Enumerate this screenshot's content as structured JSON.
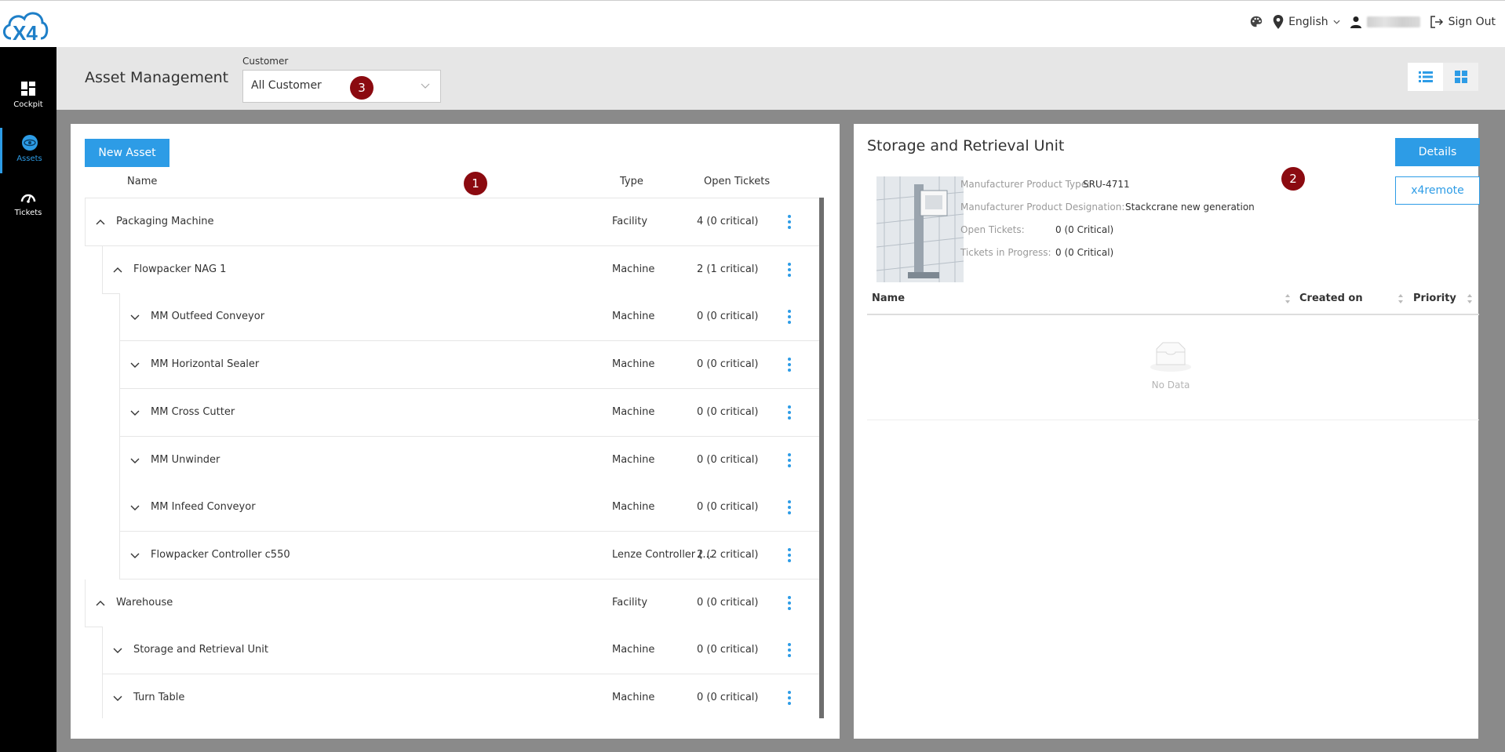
{
  "app": {
    "logo_text": "X4"
  },
  "topbar": {
    "language": "English",
    "signout": "Sign Out"
  },
  "nav": {
    "items": [
      {
        "label": "Cockpit",
        "icon": "dashboard-icon"
      },
      {
        "label": "Assets",
        "icon": "assets-icon",
        "active": true
      },
      {
        "label": "Tickets",
        "icon": "tickets-icon"
      }
    ]
  },
  "header": {
    "title": "Asset Management",
    "customer_label": "Customer",
    "customer_value": "All Customer"
  },
  "badges": [
    "1",
    "2",
    "3"
  ],
  "assets": {
    "new_button": "New Asset",
    "columns": {
      "name": "Name",
      "type": "Type",
      "open_tickets": "Open Tickets"
    },
    "rows": [
      {
        "name": "Packaging Machine",
        "type": "Facility",
        "open": "4 (0 critical)",
        "level": 0,
        "expanded": true
      },
      {
        "name": "Flowpacker NAG 1",
        "type": "Machine",
        "open": "2 (1 critical)",
        "level": 1,
        "expanded": true
      },
      {
        "name": "MM Outfeed Conveyor",
        "type": "Machine",
        "open": "0 (0 critical)",
        "level": 2,
        "expanded": false
      },
      {
        "name": "MM Horizontal Sealer",
        "type": "Machine",
        "open": "0 (0 critical)",
        "level": 2,
        "expanded": false
      },
      {
        "name": "MM Cross Cutter",
        "type": "Machine",
        "open": "0 (0 critical)",
        "level": 2,
        "expanded": false
      },
      {
        "name": "MM Unwinder",
        "type": "Machine",
        "open": "0 (0 critical)",
        "level": 2,
        "expanded": false
      },
      {
        "name": "MM Infeed Conveyor",
        "type": "Machine",
        "open": "0 (0 critical)",
        "level": 2,
        "expanded": false
      },
      {
        "name": "Flowpacker Controller c550",
        "type": "Lenze Controller (...",
        "open": "2 (2 critical)",
        "level": 2,
        "expanded": false
      },
      {
        "name": "Warehouse",
        "type": "Facility",
        "open": "0 (0 critical)",
        "level": 0,
        "expanded": true
      },
      {
        "name": "Storage and Retrieval Unit",
        "type": "Machine",
        "open": "0 (0 critical)",
        "level": 1,
        "expanded": false
      },
      {
        "name": "Turn Table",
        "type": "Machine",
        "open": "0 (0 critical)",
        "level": 1,
        "expanded": false
      }
    ]
  },
  "detail": {
    "title": "Storage and Retrieval Unit",
    "details_button": "Details",
    "remote_button": "x4remote",
    "props": [
      {
        "key": "Manufacturer Product Type:",
        "value": "SRU-4711"
      },
      {
        "key": "Manufacturer Product Designation:",
        "value": "Stackcrane new generation"
      },
      {
        "key": "Open Tickets:",
        "value": "0 (0 Critical)"
      },
      {
        "key": "Tickets in Progress:",
        "value": "0 (0 Critical)"
      }
    ],
    "table": {
      "columns": [
        "Name",
        "Created on",
        "Priority"
      ],
      "empty_text": "No Data"
    }
  },
  "colors": {
    "accent": "#2d9ce6",
    "badge": "#8b0a10",
    "nav_bg": "#000000"
  }
}
